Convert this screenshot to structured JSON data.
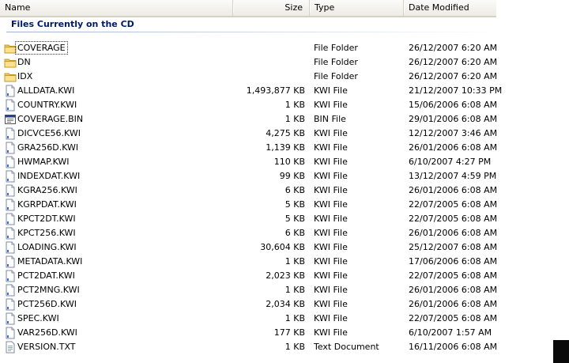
{
  "columns": {
    "name": "Name",
    "size": "Size",
    "type": "Type",
    "date": "Date Modified"
  },
  "group": {
    "title": "Files Currently on the CD"
  },
  "files": [
    {
      "name": "COVERAGE",
      "size": "",
      "type": "File Folder",
      "date": "26/12/2007 6:20 AM",
      "icon": "folder-icon"
    },
    {
      "name": "DN",
      "size": "",
      "type": "File Folder",
      "date": "26/12/2007 6:20 AM",
      "icon": "folder-icon"
    },
    {
      "name": "IDX",
      "size": "",
      "type": "File Folder",
      "date": "26/12/2007 6:20 AM",
      "icon": "folder-icon"
    },
    {
      "name": "ALLDATA.KWI",
      "size": "1,493,877 KB",
      "type": "KWI File",
      "date": "21/12/2007 10:33 PM",
      "icon": "file-icon"
    },
    {
      "name": "COUNTRY.KWI",
      "size": "1 KB",
      "type": "KWI File",
      "date": "15/06/2006 6:08 AM",
      "icon": "file-icon"
    },
    {
      "name": "COVERAGE.BIN",
      "size": "1 KB",
      "type": "BIN File",
      "date": "29/01/2006 6:08 AM",
      "icon": "bin-file-icon"
    },
    {
      "name": "DICVCE56.KWI",
      "size": "4,275 KB",
      "type": "KWI File",
      "date": "12/12/2007 3:46 AM",
      "icon": "file-icon"
    },
    {
      "name": "GRA256D.KWI",
      "size": "1,139 KB",
      "type": "KWI File",
      "date": "26/01/2006 6:08 AM",
      "icon": "file-icon"
    },
    {
      "name": "HWMAP.KWI",
      "size": "110 KB",
      "type": "KWI File",
      "date": "6/10/2007 4:27 PM",
      "icon": "file-icon"
    },
    {
      "name": "INDEXDAT.KWI",
      "size": "99 KB",
      "type": "KWI File",
      "date": "13/12/2007 4:59 PM",
      "icon": "file-icon"
    },
    {
      "name": "KGRA256.KWI",
      "size": "6 KB",
      "type": "KWI File",
      "date": "26/01/2006 6:08 AM",
      "icon": "file-icon"
    },
    {
      "name": "KGRPDAT.KWI",
      "size": "5 KB",
      "type": "KWI File",
      "date": "22/07/2005 6:08 AM",
      "icon": "file-icon"
    },
    {
      "name": "KPCT2DT.KWI",
      "size": "5 KB",
      "type": "KWI File",
      "date": "22/07/2005 6:08 AM",
      "icon": "file-icon"
    },
    {
      "name": "KPCT256.KWI",
      "size": "6 KB",
      "type": "KWI File",
      "date": "26/01/2006 6:08 AM",
      "icon": "file-icon"
    },
    {
      "name": "LOADING.KWI",
      "size": "30,604 KB",
      "type": "KWI File",
      "date": "25/12/2007 6:08 AM",
      "icon": "file-icon"
    },
    {
      "name": "METADATA.KWI",
      "size": "1 KB",
      "type": "KWI File",
      "date": "17/06/2006 6:08 AM",
      "icon": "file-icon"
    },
    {
      "name": "PCT2DAT.KWI",
      "size": "2,023 KB",
      "type": "KWI File",
      "date": "22/07/2005 6:08 AM",
      "icon": "file-icon"
    },
    {
      "name": "PCT2MNG.KWI",
      "size": "1 KB",
      "type": "KWI File",
      "date": "26/01/2006 6:08 AM",
      "icon": "file-icon"
    },
    {
      "name": "PCT256D.KWI",
      "size": "2,034 KB",
      "type": "KWI File",
      "date": "26/01/2006 6:08 AM",
      "icon": "file-icon"
    },
    {
      "name": "SPEC.KWI",
      "size": "1 KB",
      "type": "KWI File",
      "date": "22/07/2005 6:08 AM",
      "icon": "file-icon"
    },
    {
      "name": "VAR256D.KWI",
      "size": "177 KB",
      "type": "KWI File",
      "date": "6/10/2007 1:57 AM",
      "icon": "file-icon"
    },
    {
      "name": "VERSION.TXT",
      "size": "1 KB",
      "type": "Text Document",
      "date": "16/11/2006 6:08 AM",
      "icon": "text-file-icon"
    }
  ]
}
